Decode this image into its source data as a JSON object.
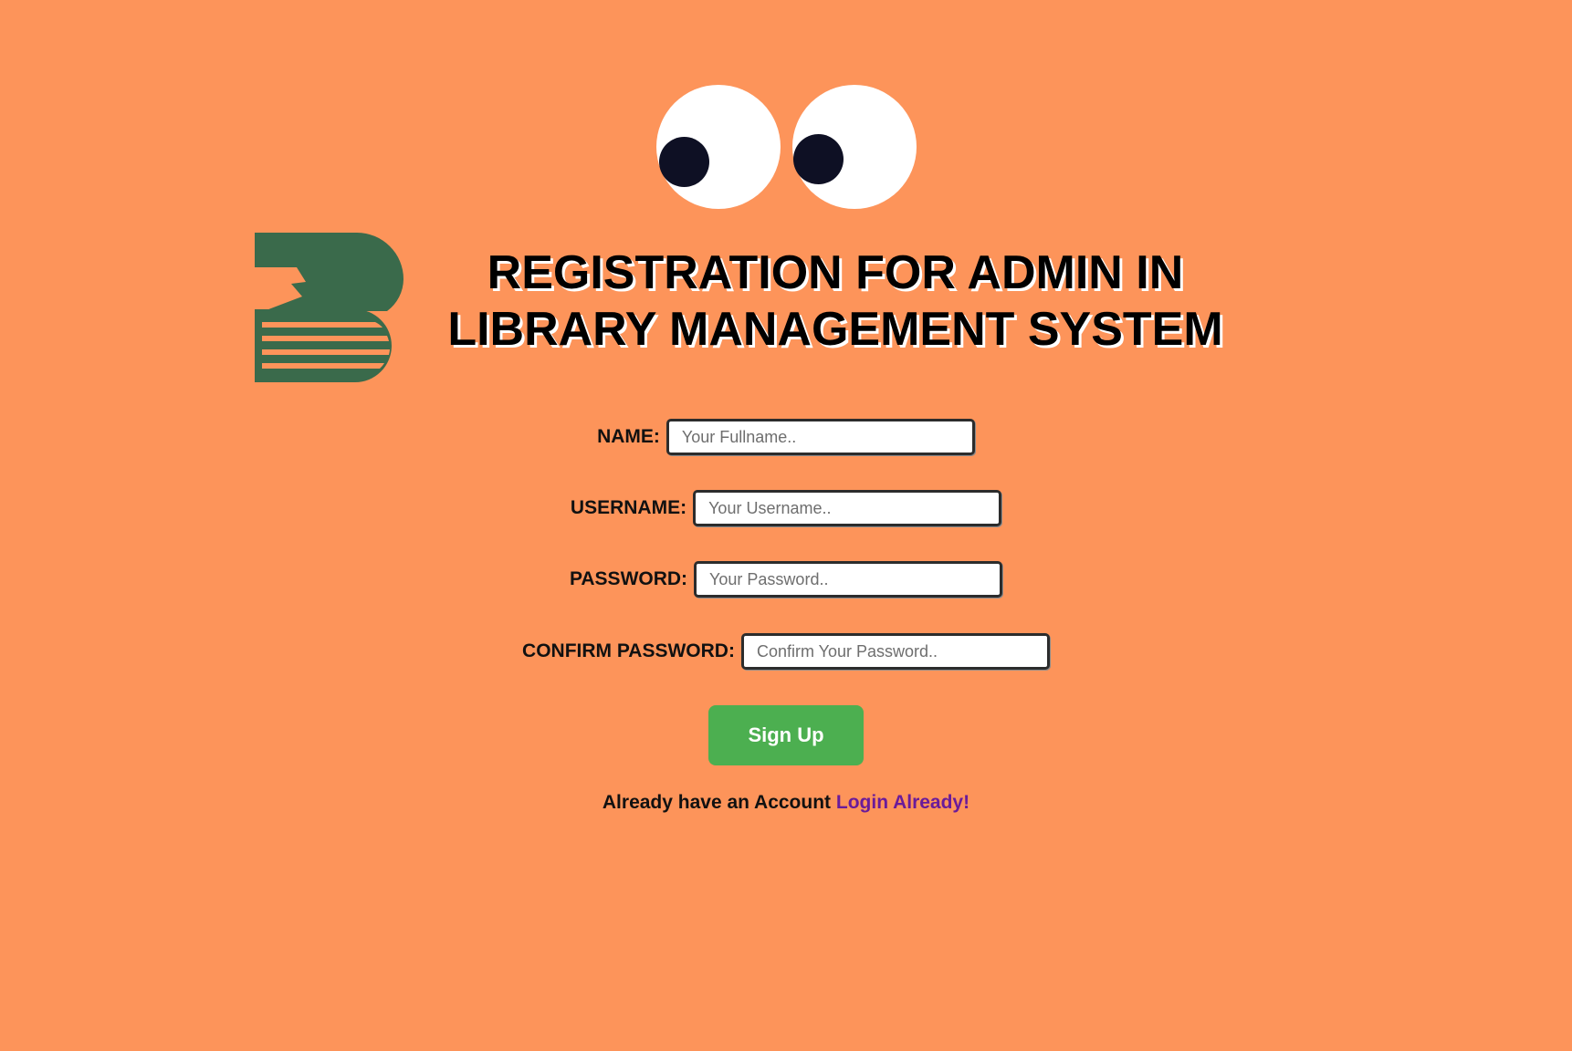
{
  "header": {
    "title_line1": "REGISTRATION FOR ADMIN IN",
    "title_line2": "LIBRARY MANAGEMENT SYSTEM",
    "logo_icon": "book-logo-icon",
    "mascot_icon": "googly-eyes-icon"
  },
  "form": {
    "name": {
      "label": "NAME:",
      "placeholder": "Your Fullname..",
      "value": ""
    },
    "username": {
      "label": "USERNAME:",
      "placeholder": "Your Username..",
      "value": ""
    },
    "password": {
      "label": "PASSWORD:",
      "placeholder": "Your Password..",
      "value": ""
    },
    "confirm_password": {
      "label": "CONFIRM PASSWORD:",
      "placeholder": "Confirm Your Password..",
      "value": ""
    },
    "submit_label": "Sign Up"
  },
  "footer": {
    "prompt": "Already have an Account",
    "login_link": "Login Already!"
  },
  "colors": {
    "background": "#fd945a",
    "logo": "#3a6a4b",
    "button": "#4caf50",
    "link": "#6a1b9a"
  }
}
